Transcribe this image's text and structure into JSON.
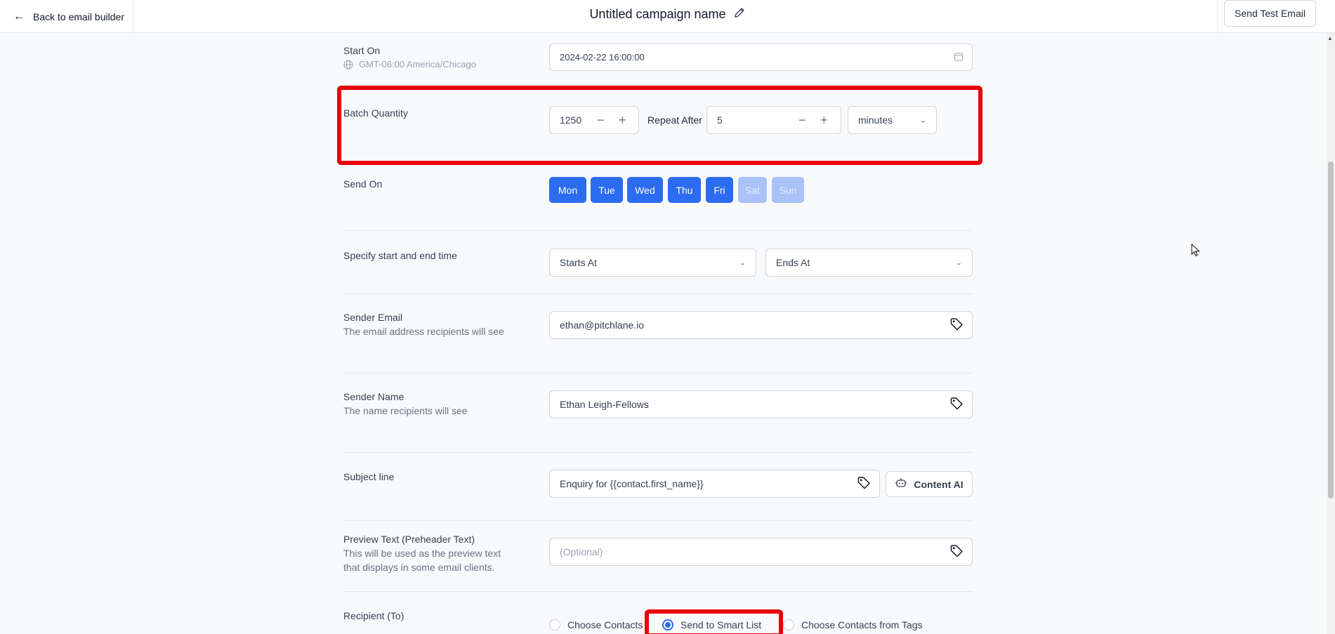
{
  "header": {
    "back_label": "Back to email builder",
    "campaign_name": "Untitled campaign name",
    "send_test_label": "Send Test Email"
  },
  "start_on": {
    "label": "Start On",
    "timezone": "GMT-06:00 America/Chicago",
    "value": "2024-02-22 16:00:00"
  },
  "batch": {
    "label": "Batch Quantity",
    "quantity": "1250",
    "repeat_label": "Repeat After",
    "repeat_value": "5",
    "unit": "minutes"
  },
  "send_on": {
    "label": "Send On",
    "days": [
      {
        "label": "Mon",
        "selected": true
      },
      {
        "label": "Tue",
        "selected": true
      },
      {
        "label": "Wed",
        "selected": true
      },
      {
        "label": "Thu",
        "selected": true
      },
      {
        "label": "Fri",
        "selected": true
      },
      {
        "label": "Sat",
        "selected": false
      },
      {
        "label": "Sun",
        "selected": false
      }
    ]
  },
  "time_window": {
    "label": "Specify start and end time",
    "starts_placeholder": "Starts At",
    "ends_placeholder": "Ends At"
  },
  "sender_email": {
    "label": "Sender Email",
    "help": "The email address recipients will see",
    "value": "ethan@pitchlane.io"
  },
  "sender_name": {
    "label": "Sender Name",
    "help": "The name recipients will see",
    "value": "Ethan Leigh-Fellows"
  },
  "subject": {
    "label": "Subject line",
    "value": "Enquiry for {{contact.first_name}}",
    "content_ai_label": "Content AI"
  },
  "preview_text": {
    "label": "Preview Text (Preheader Text)",
    "help_line1": "This will be used as the preview text",
    "help_line2": "that displays in some email clients.",
    "placeholder": "(Optional)"
  },
  "recipient": {
    "label": "Recipient (To)",
    "options": [
      {
        "label": "Choose Contacts",
        "selected": false
      },
      {
        "label": "Send to Smart List",
        "selected": true
      },
      {
        "label": "Choose Contacts from Tags",
        "selected": false
      }
    ]
  },
  "colors": {
    "accent": "#2b6cf0",
    "highlight": "#e8000a"
  }
}
